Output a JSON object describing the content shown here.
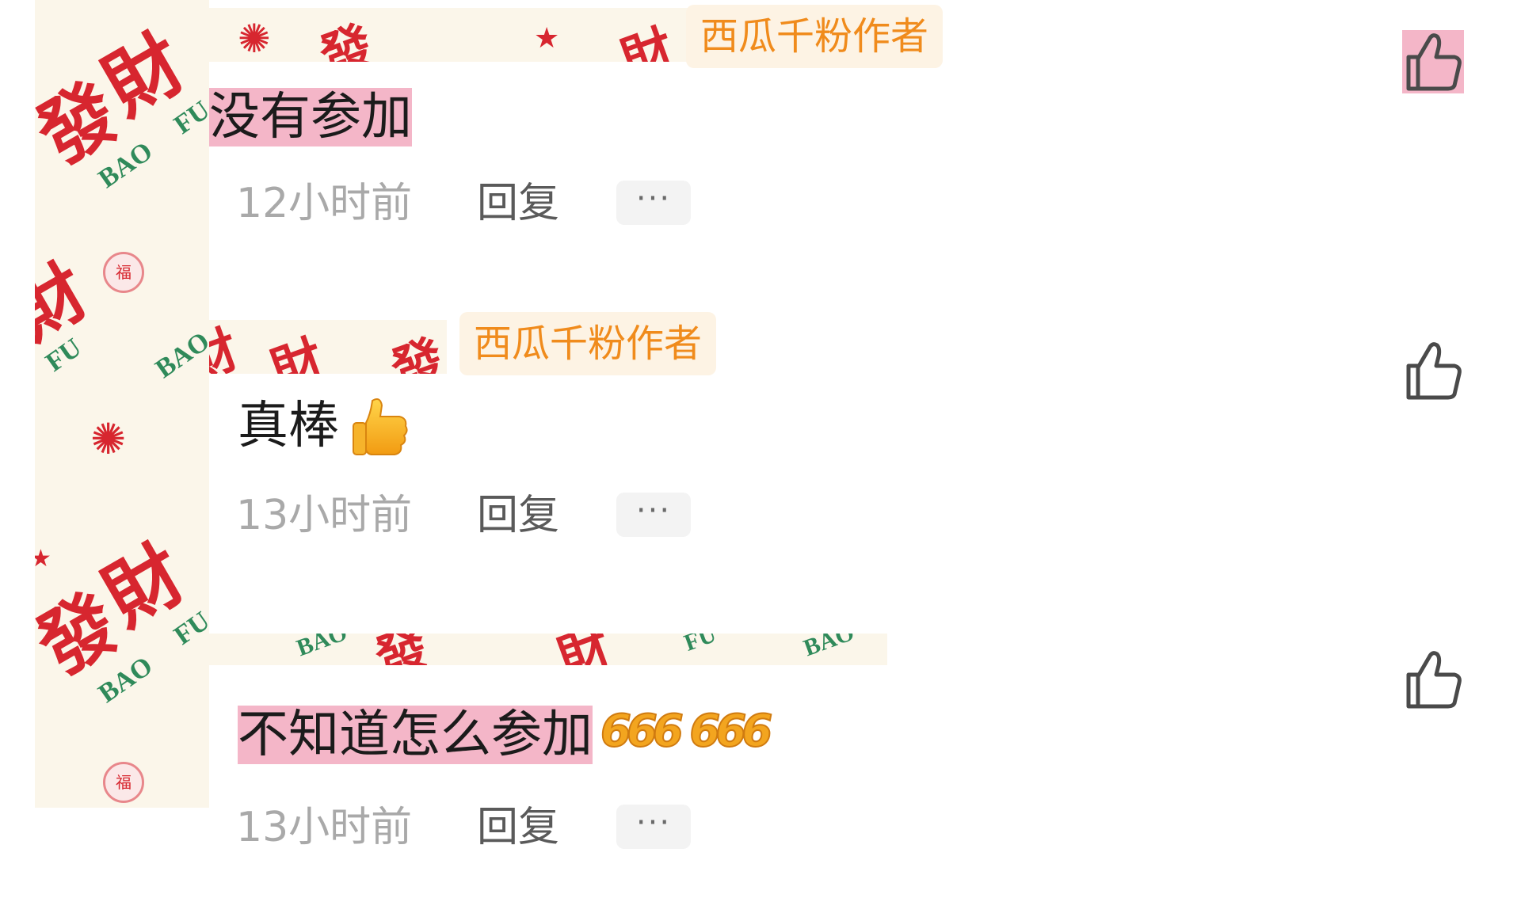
{
  "comments": [
    {
      "badge": "西瓜千粉作者",
      "text": "没有参加",
      "text_emoji": "",
      "time": "12小时前",
      "reply_label": "回复",
      "more_label": "···",
      "liked": true
    },
    {
      "badge": "西瓜千粉作者",
      "text": "真棒",
      "text_emoji": "👍",
      "time": "13小时前",
      "reply_label": "回复",
      "more_label": "···",
      "liked": false
    },
    {
      "badge": "",
      "text": "不知道怎么参加",
      "text_emoji": "666 666",
      "time": "13小时前",
      "reply_label": "回复",
      "more_label": "···",
      "liked": false
    }
  ],
  "decor": {
    "avatar_pattern_glyph_1": "發",
    "avatar_pattern_glyph_2": "財",
    "avatar_pattern_en_1": "BAO",
    "avatar_pattern_en_2": "FU",
    "avatar_pattern_seal": "福"
  },
  "icons": {
    "like": "thumbs-up-outline-icon",
    "more": "ellipsis-icon"
  },
  "colors": {
    "badge_text": "#f08b1c",
    "badge_bg": "#fdf3e4",
    "highlight": "#f4b6c8",
    "time_text": "#a9a9a9",
    "reply_text": "#5a5a5a",
    "pattern_red": "#d7262f",
    "pattern_green": "#2f8a5a"
  }
}
